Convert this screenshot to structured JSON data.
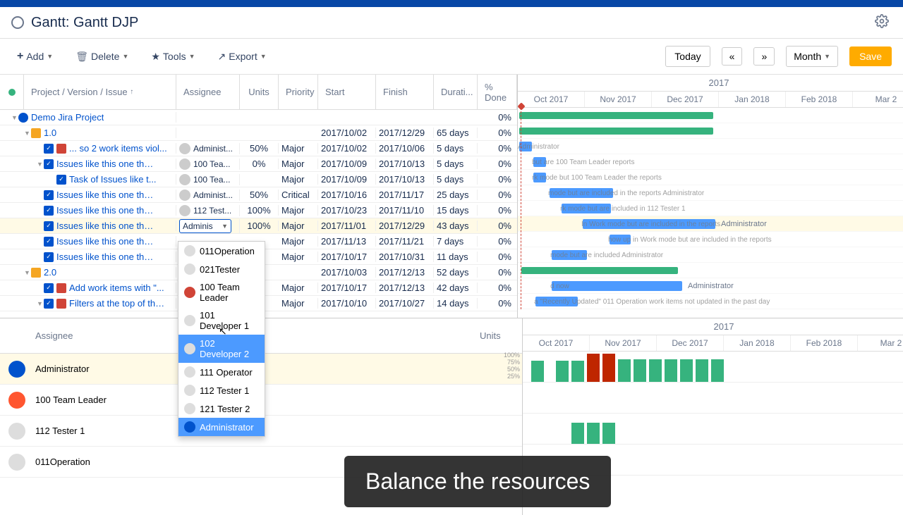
{
  "header": {
    "title_prefix": "Gantt:",
    "title": "Gantt DJP"
  },
  "toolbar": {
    "add": "Add",
    "delete": "Delete",
    "tools": "Tools",
    "export": "Export",
    "today": "Today",
    "prev": "«",
    "next": "»",
    "scale": "Month",
    "save": "Save"
  },
  "grid_headers": {
    "project": "Project / Version / Issue",
    "assignee": "Assignee",
    "units": "Units",
    "priority": "Priority",
    "start": "Start",
    "finish": "Finish",
    "duration": "Durati...",
    "done": "% Done"
  },
  "rows": [
    {
      "indent": 0,
      "icon": "proj",
      "label": "Demo Jira Project",
      "assignee": "",
      "units": "",
      "priority": "",
      "start": "",
      "finish": "",
      "duration": "",
      "done": "0%",
      "toggle": "▼"
    },
    {
      "indent": 1,
      "icon": "box",
      "label": "1.0",
      "assignee": "",
      "units": "",
      "priority": "",
      "start": "2017/10/02",
      "finish": "2017/12/29",
      "duration": "65 days",
      "done": "0%",
      "toggle": "▼"
    },
    {
      "indent": 2,
      "icon": "story",
      "label": "... so 2 work items viol...",
      "assignee": "Administ...",
      "units": "50%",
      "priority": "Major",
      "start": "2017/10/02",
      "finish": "2017/10/06",
      "duration": "5 days",
      "done": "0%",
      "check": true
    },
    {
      "indent": 2,
      "icon": "chk",
      "label": "Issues like this one tha...",
      "assignee": "100 Tea...",
      "units": "0%",
      "priority": "Major",
      "start": "2017/10/09",
      "finish": "2017/10/13",
      "duration": "5 days",
      "done": "0%",
      "toggle": "▼",
      "check": true
    },
    {
      "indent": 3,
      "icon": "chk",
      "label": "Task of Issues like t...",
      "assignee": "100 Tea...",
      "units": "",
      "priority": "Major",
      "start": "2017/10/09",
      "finish": "2017/10/13",
      "duration": "5 days",
      "done": "0%",
      "check": true
    },
    {
      "indent": 2,
      "icon": "chk",
      "label": "Issues like this one tha...",
      "assignee": "Administ...",
      "units": "50%",
      "priority": "Critical",
      "start": "2017/10/16",
      "finish": "2017/11/17",
      "duration": "25 days",
      "done": "0%",
      "check": true
    },
    {
      "indent": 2,
      "icon": "chk",
      "label": "Issues like this one tha...",
      "assignee": "112 Test...",
      "units": "100%",
      "priority": "Major",
      "start": "2017/10/23",
      "finish": "2017/11/10",
      "duration": "15 days",
      "done": "0%",
      "check": true
    },
    {
      "indent": 2,
      "icon": "chk",
      "label": "Issues like this one tha...",
      "assignee": "Adminis",
      "units": "100%",
      "priority": "Major",
      "start": "2017/11/01",
      "finish": "2017/12/29",
      "duration": "43 days",
      "done": "0%",
      "selected": true,
      "combo": true,
      "check": true
    },
    {
      "indent": 2,
      "icon": "chk",
      "label": "Issues like this one tha...",
      "assignee": "",
      "units": "",
      "priority": "Major",
      "start": "2017/11/13",
      "finish": "2017/11/21",
      "duration": "7 days",
      "done": "0%",
      "check": true
    },
    {
      "indent": 2,
      "icon": "chk",
      "label": "Issues like this one tha...",
      "assignee": "",
      "units": "",
      "priority": "Major",
      "start": "2017/10/17",
      "finish": "2017/10/31",
      "duration": "11 days",
      "done": "0%",
      "check": true
    },
    {
      "indent": 1,
      "icon": "box",
      "label": "2.0",
      "assignee": "",
      "units": "",
      "priority": "",
      "start": "2017/10/03",
      "finish": "2017/12/13",
      "duration": "52 days",
      "done": "0%",
      "toggle": "▼"
    },
    {
      "indent": 2,
      "icon": "story",
      "label": "Add work items with \"...",
      "assignee": "",
      "units": "",
      "priority": "Major",
      "start": "2017/10/17",
      "finish": "2017/12/13",
      "duration": "42 days",
      "done": "0%",
      "check": true
    },
    {
      "indent": 2,
      "icon": "story",
      "label": "Filters at the top of the...",
      "assignee": "",
      "units": "",
      "priority": "Major",
      "start": "2017/10/10",
      "finish": "2017/10/27",
      "duration": "14 days",
      "done": "0%",
      "toggle": "▼",
      "check": true
    }
  ],
  "timeline_year": "2017",
  "timeline_months": [
    "Oct 2017",
    "Nov 2017",
    "Dec 2017",
    "Jan 2018",
    "Feb 2018",
    "Mar 2"
  ],
  "bar_labels": [
    "",
    "",
    "Administrator",
    "but are 100 Team Leader reports",
    "rk mode but 100 Team Leader the reports",
    "mode but are included in the reports    Administrator",
    "rk mode but are included in 112 Tester 1",
    "In Work mode but are included in the reports",
    "how up in Work mode but are included in the reports",
    "mode but are included Administrator",
    "",
    "d now",
    "a \"Recently Updated\" 011 Operation work items not updated in the past day"
  ],
  "bar_label_admin": "Administrator",
  "bar_label_admin2": "Administrator",
  "dropdown_items": [
    {
      "label": "011Operation",
      "avatar": "gray"
    },
    {
      "label": "021Tester",
      "avatar": "gray"
    },
    {
      "label": "100 Team Leader",
      "avatar": "red"
    },
    {
      "label": "101 Developer 1",
      "avatar": "gray"
    },
    {
      "label": "102 Developer 2",
      "avatar": "gray",
      "hover": true
    },
    {
      "label": "111 Operator",
      "avatar": "gray"
    },
    {
      "label": "112 Tester 1",
      "avatar": "gray"
    },
    {
      "label": "121 Tester 2",
      "avatar": "gray"
    },
    {
      "label": "Administrator",
      "avatar": "blue",
      "current": true
    }
  ],
  "lower_header": {
    "assignee": "Assignee",
    "units": "Units"
  },
  "resources": [
    {
      "name": "Administrator",
      "avatar": "blue",
      "selected": true
    },
    {
      "name": "100 Team Leader",
      "avatar": "red"
    },
    {
      "name": "112 Tester 1",
      "avatar": "gray"
    },
    {
      "name": "011Operation",
      "avatar": "gray"
    }
  ],
  "pct_scale": [
    "100%",
    "75%",
    "50%",
    "25%"
  ],
  "tooltip": "Balance the resources"
}
